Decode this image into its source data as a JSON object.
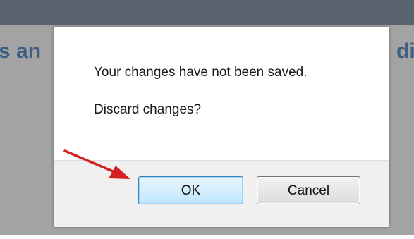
{
  "background": {
    "heading_left": "s an",
    "heading_right": "di"
  },
  "dialog": {
    "message_line_1": "Your changes have not been saved.",
    "message_line_2": "Discard changes?",
    "ok_label": "OK",
    "cancel_label": "Cancel"
  },
  "annotation": {
    "arrow_icon": "red-arrow-icon",
    "arrow_color": "#d42020"
  },
  "colors": {
    "heading": "#3e5f85",
    "top_bar": "#5a6470",
    "ok_border": "#3c7fb1"
  }
}
